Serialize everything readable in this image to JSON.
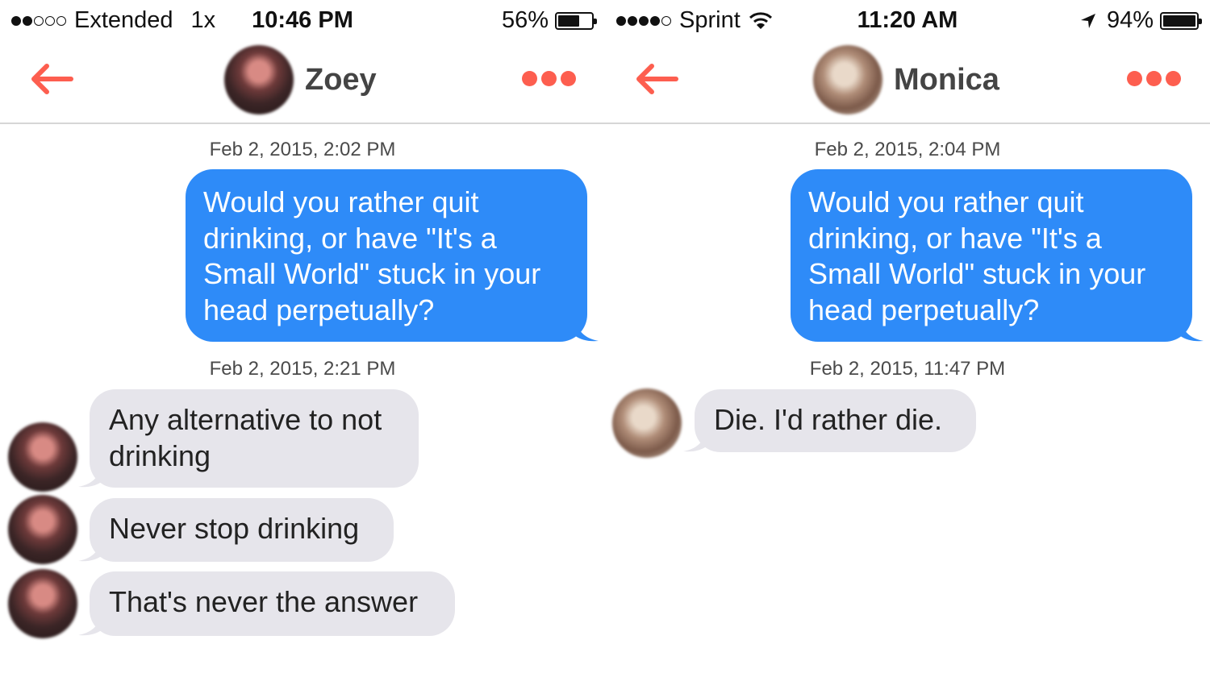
{
  "left": {
    "status": {
      "carrier": "Extended",
      "zoom": "1x",
      "time": "10:46 PM",
      "battery": "56%",
      "battery_level": 0.56,
      "signal_bars": 2
    },
    "contact": {
      "name": "Zoey",
      "avatar_icon": "avatar-photo"
    },
    "messages": [
      {
        "timestamp": "Feb 2, 2015, 2:02 PM",
        "direction": "outgoing",
        "text": "Would you rather quit drinking, or have \"It's a Small World\" stuck in your head perpetually?"
      },
      {
        "timestamp": "Feb 2, 2015, 2:21 PM",
        "direction": "incoming",
        "text": "Any alternative to not drinking"
      },
      {
        "direction": "incoming",
        "text": "Never stop drinking"
      },
      {
        "direction": "incoming",
        "text": "That's never the answer"
      }
    ]
  },
  "right": {
    "status": {
      "carrier": "Sprint",
      "time": "11:20 AM",
      "battery": "94%",
      "battery_level": 0.94,
      "signal_bars": 4
    },
    "contact": {
      "name": "Monica",
      "avatar_icon": "avatar-photo"
    },
    "messages": [
      {
        "timestamp": "Feb 2, 2015, 2:04 PM",
        "direction": "outgoing",
        "text": "Would you rather quit drinking, or have \"It's a Small World\" stuck in your head perpetually?"
      },
      {
        "timestamp": "Feb 2, 2015, 11:47 PM",
        "direction": "incoming",
        "text": "Die. I'd rather die."
      }
    ]
  },
  "colors": {
    "accent": "#fd5e4f",
    "outgoing_bubble": "#2e8bf8",
    "incoming_bubble": "#e6e5eb"
  }
}
